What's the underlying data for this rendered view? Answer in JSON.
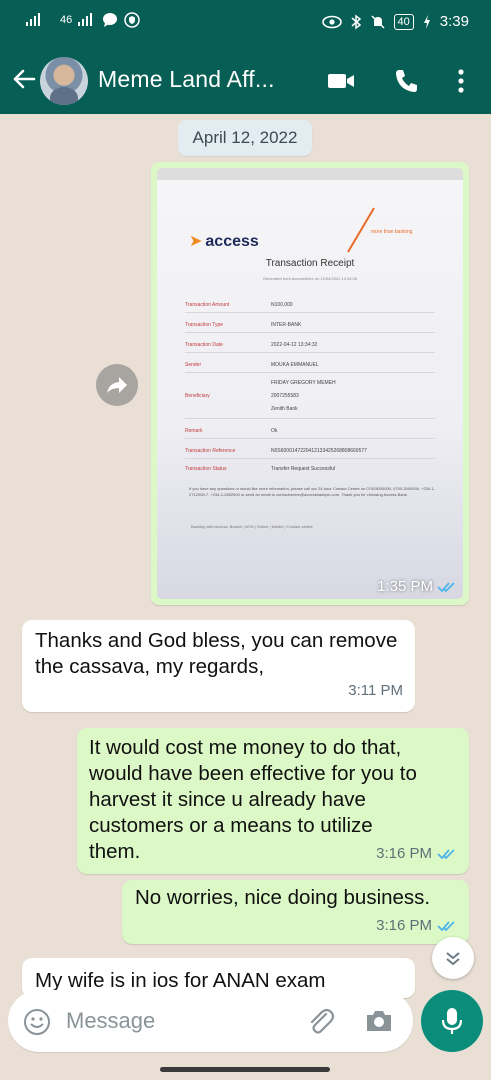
{
  "status_bar": {
    "signal_left": "46",
    "time": "3:39",
    "battery": "40"
  },
  "header": {
    "title": "Meme Land Aff...",
    "icons": [
      "back-arrow-icon",
      "video-call-icon",
      "voice-call-icon",
      "more-vertical-icon"
    ]
  },
  "date_chip": "April 12, 2022",
  "image_message": {
    "time": "1:35 PM",
    "receipt": {
      "brand": "access",
      "brand_tagline": "more than banking",
      "title": "Transaction Receipt",
      "subtitle": "Generated from AccessMore on 12/04/2022 13:34:36",
      "rows": [
        {
          "label": "Transaction Amount",
          "value": "N100,000"
        },
        {
          "label": "Transaction Type",
          "value": "INTER-BANK"
        },
        {
          "label": "Transaction Date",
          "value": "2022-04-12 13:34:32"
        },
        {
          "label": "Sender",
          "value": "MOUKA EMMANUEL"
        },
        {
          "label": "Beneficiary",
          "value": "FRIDAY GREGORY MEMEH"
        },
        {
          "label": "",
          "value": "2007255583"
        },
        {
          "label": "",
          "value": "Zenith Bank"
        },
        {
          "label": "Remark",
          "value": "Ok"
        },
        {
          "label": "Transaction Reference",
          "value": "N0S6000147220412133425268808669577"
        },
        {
          "label": "Transaction Status",
          "value": "Transfer Request Successful"
        }
      ],
      "note": "If you have any questions or would like more information, please call our 24-hour Contact Centre on 07003000000, 0700-3000000, +234-1-2712005-7, +234-1-2802500 or send an email to contactcentre@accessbankplc.com. Thank you for choosing Access Bank.",
      "footer": "Banking with Access: Branch | ATM | Online | Mobile | Contact centre"
    }
  },
  "messages": [
    {
      "id": "m1",
      "direction": "in",
      "text": "Thanks and God bless, you can remove the cassava, my regards,",
      "time": "3:11 PM"
    },
    {
      "id": "m2",
      "direction": "out",
      "text": "It would cost me money to do that, would have been effective for you to harvest it since u already have customers or a means to utilize them.",
      "time": "3:16 PM"
    },
    {
      "id": "m3",
      "direction": "out",
      "text": "No worries, nice doing business.",
      "time": "3:16 PM"
    },
    {
      "id": "m4",
      "direction": "in",
      "text": "My wife is in ios for ANAN exam"
    }
  ],
  "composer": {
    "placeholder": "Message"
  },
  "colors": {
    "header": "#075e54",
    "chat_bg": "#e9dfd4",
    "outgoing_bubble": "#dcf8c6",
    "incoming_bubble": "#ffffff",
    "read_ticks": "#4fb6ec",
    "mic_button": "#0a8d7a"
  }
}
